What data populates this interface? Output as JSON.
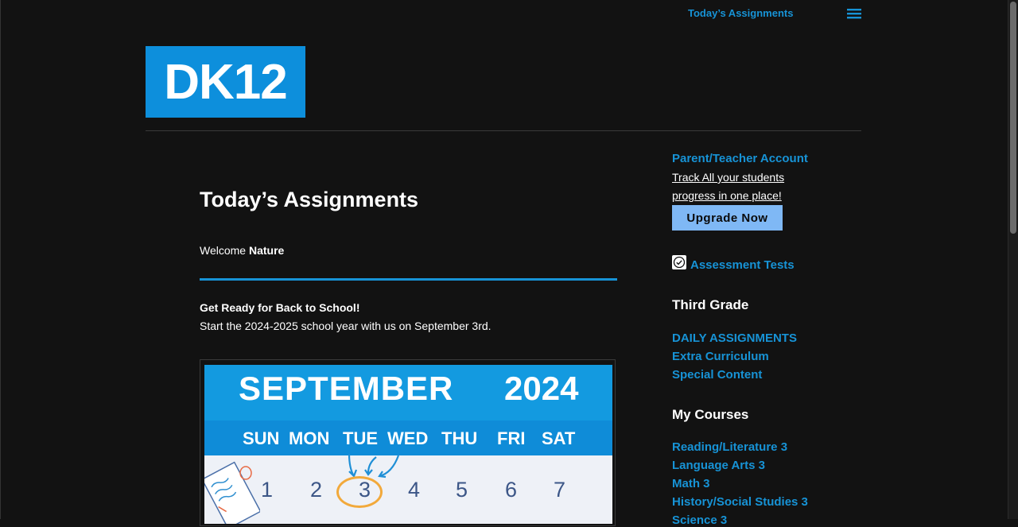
{
  "topbar": {
    "link_label": "Today’s Assignments",
    "menu_icon": "hamburger-menu-icon"
  },
  "logo": {
    "text": "DK12",
    "color": "#0d8fdc"
  },
  "main": {
    "title": "Today’s Assignments",
    "welcome_prefix": "Welcome",
    "welcome_name": "Nature",
    "notice_title": "Get Ready for Back to School!",
    "notice_text": "Start the 2024-2025 school year with us on September 3rd.",
    "calendar": {
      "month": "SEPTEMBER",
      "year": "2024",
      "days": [
        "SUN",
        "MON",
        "TUE",
        "WED",
        "THU",
        "FRI",
        "SAT"
      ],
      "dates": [
        "1",
        "2",
        "3",
        "4",
        "5",
        "6",
        "7"
      ],
      "highlighted_date": "3"
    }
  },
  "sidebar": {
    "account_link": "Parent/Teacher Account",
    "track_line1": "Track All your students",
    "track_line2": "progress in one place!",
    "upgrade_label": "Upgrade Now",
    "assessment_link": "Assessment Tests",
    "grade_heading": "Third Grade",
    "grade_links": [
      "DAILY ASSIGNMENTS",
      "Extra Curriculum",
      "Special Content"
    ],
    "courses_heading": "My Courses",
    "courses": [
      "Reading/Literature 3",
      "Language Arts 3",
      "Math 3",
      "History/Social Studies 3",
      "Science 3"
    ]
  },
  "colors": {
    "accent": "#1793d6",
    "background": "#121212",
    "button": "#7fb8f5"
  }
}
